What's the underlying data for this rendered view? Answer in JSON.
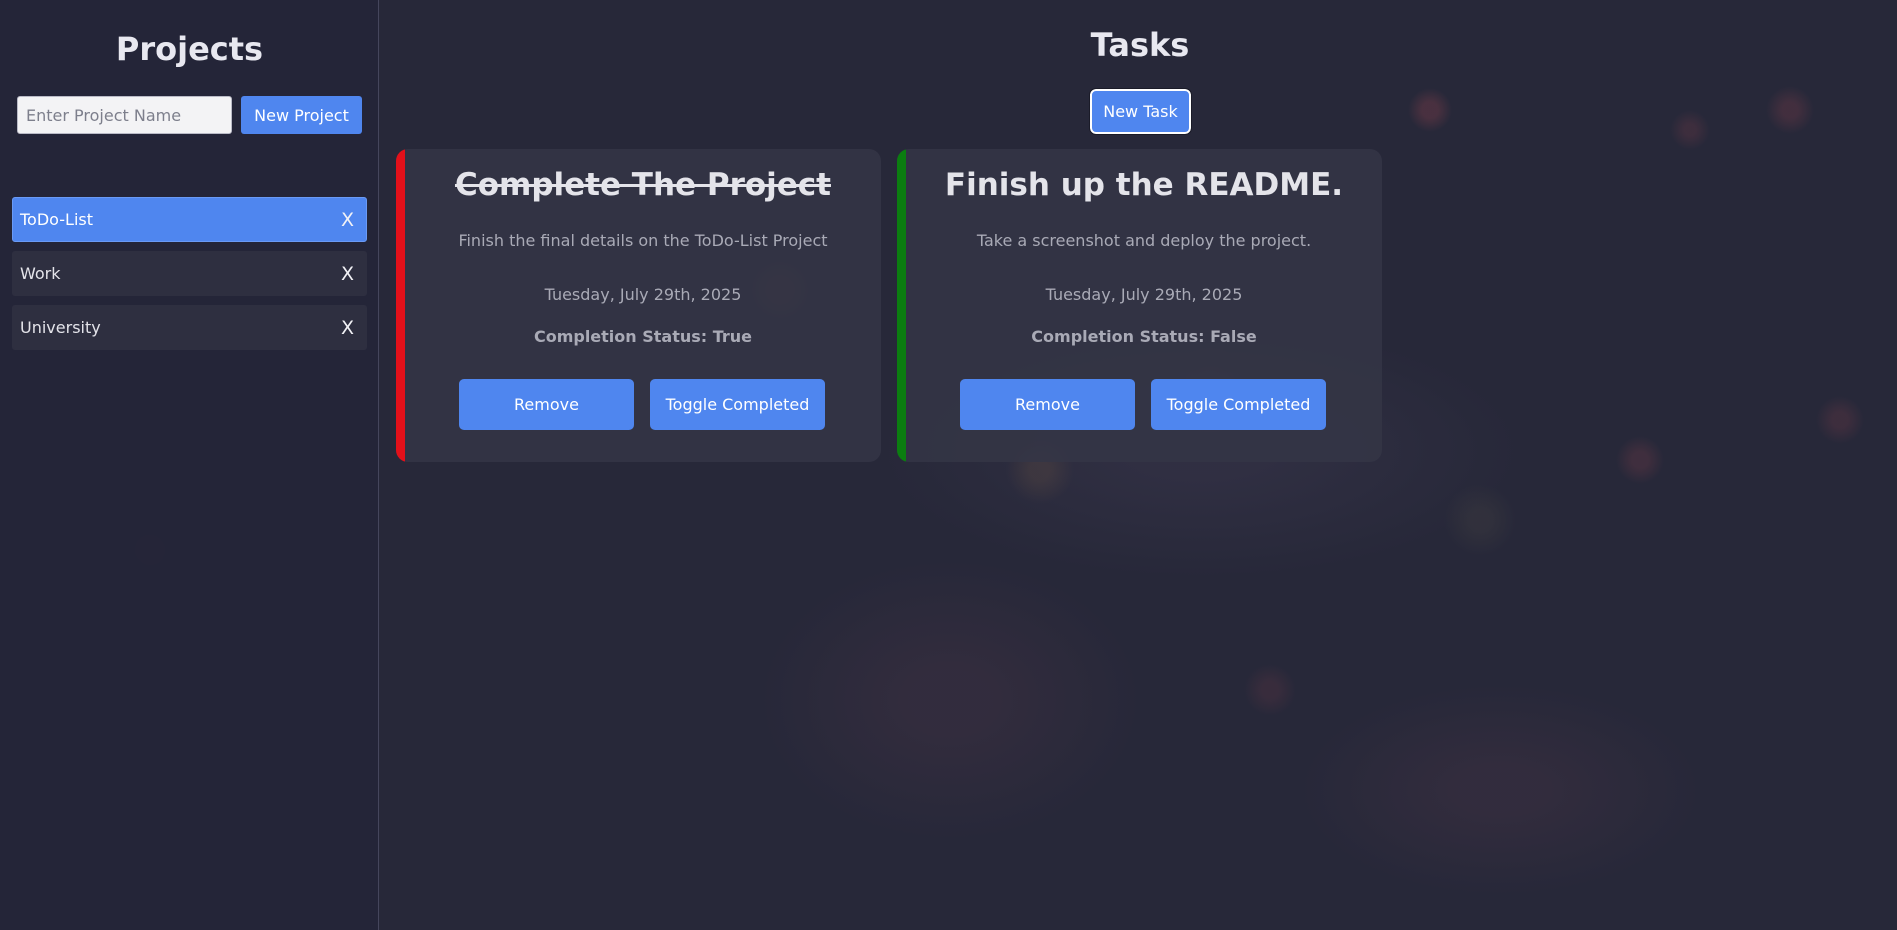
{
  "sidebar": {
    "title": "Projects",
    "input_placeholder": "Enter Project Name",
    "new_project_label": "New Project",
    "close_glyph": "X",
    "projects": [
      {
        "name": "ToDo-List",
        "active": true
      },
      {
        "name": "Work",
        "active": false
      },
      {
        "name": "University",
        "active": false
      }
    ]
  },
  "main": {
    "title": "Tasks",
    "new_task_label": "New Task",
    "tasks": [
      {
        "title": "Complete The Project",
        "description": "Finish the final details on the ToDo-List Project",
        "date": "Tuesday, July 29th, 2025",
        "status": "Completion Status: True",
        "completed": true,
        "bar_color": "#e3101a",
        "remove_label": "Remove",
        "toggle_label": "Toggle Completed"
      },
      {
        "title": "Finish up the README.",
        "description": "Take a screenshot and deploy the project.",
        "date": "Tuesday, July 29th, 2025",
        "status": "Completion Status: False",
        "completed": false,
        "bar_color": "#0b7d10",
        "remove_label": "Remove",
        "toggle_label": "Toggle Completed"
      }
    ]
  },
  "colors": {
    "accent": "#4f86ef",
    "background": "#272839"
  }
}
